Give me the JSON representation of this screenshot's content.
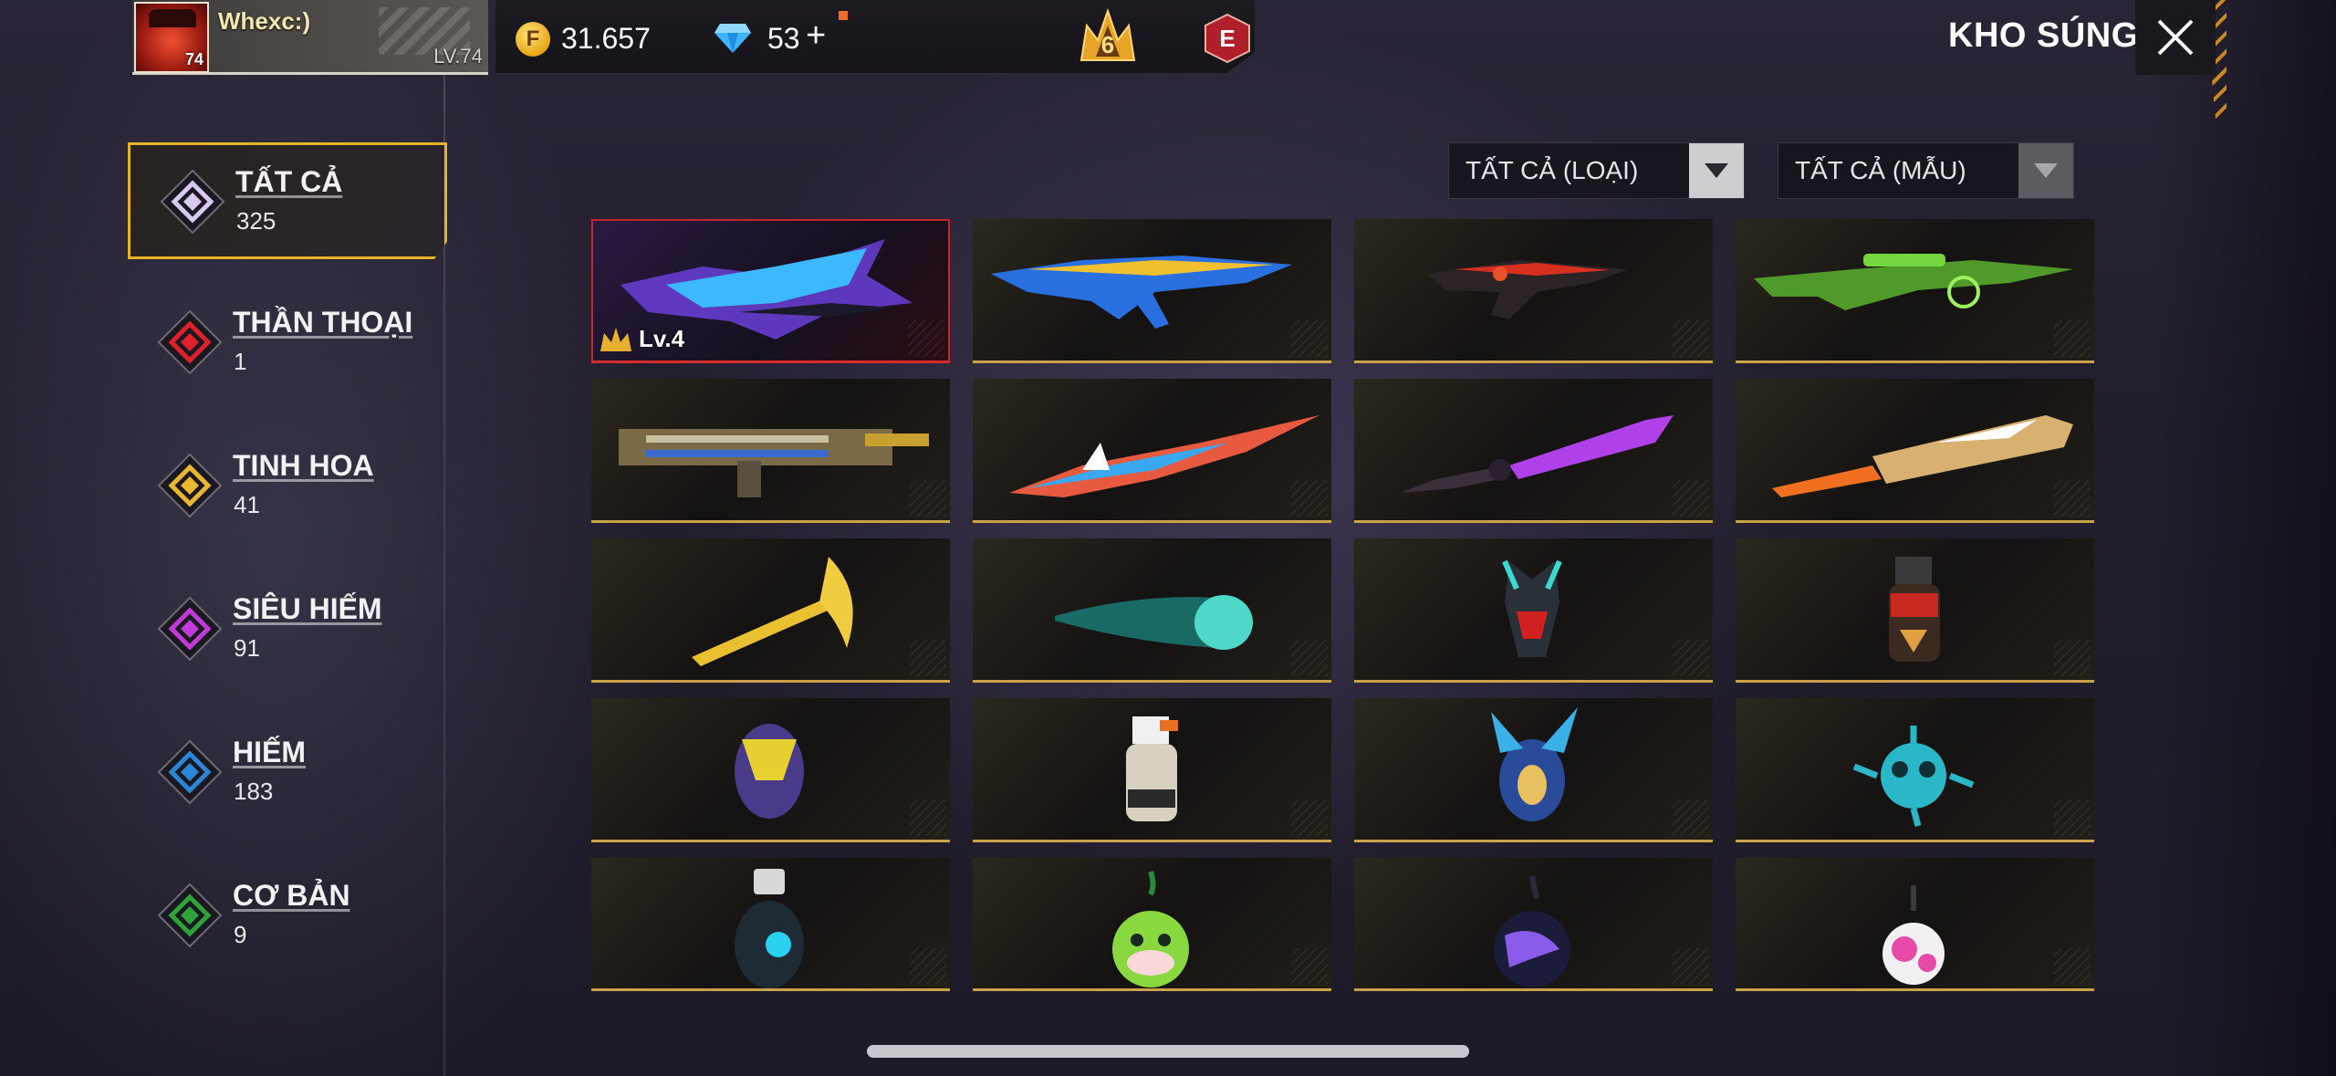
{
  "player": {
    "name": "Whexc:)",
    "avatar_level": "74",
    "level_label": "LV.74"
  },
  "currency": {
    "coins": "31.657",
    "diamonds": "53",
    "plus": "+",
    "crown_rank": "6",
    "elite_letter": "E"
  },
  "header": {
    "title": "KHO SÚNG"
  },
  "categories": [
    {
      "label": "TẤT CẢ",
      "count": "325",
      "color": "#d9c8f0"
    },
    {
      "label": "THẦN THOẠI",
      "count": "1",
      "color": "#e0202a"
    },
    {
      "label": "TINH HOA",
      "count": "41",
      "color": "#e9b630"
    },
    {
      "label": "SIÊU HIẾM",
      "count": "91",
      "color": "#c03ad8"
    },
    {
      "label": "HIẾM",
      "count": "183",
      "color": "#2c86d8"
    },
    {
      "label": "CƠ BẢN",
      "count": "9",
      "color": "#2da33a"
    }
  ],
  "filters": {
    "type_label": "TẤT CẢ (LOẠI)",
    "style_label": "TẤT CẢ (MẪU)"
  },
  "items": [
    {
      "kind": "dragon-rifle-icon",
      "badge": "Lv.4"
    },
    {
      "kind": "blue-gold-rifle-icon"
    },
    {
      "kind": "black-red-rifle-icon"
    },
    {
      "kind": "green-sniper-icon"
    },
    {
      "kind": "gold-heavy-rifle-icon"
    },
    {
      "kind": "blue-red-blade-icon"
    },
    {
      "kind": "purple-sword-icon"
    },
    {
      "kind": "cricket-bat-icon"
    },
    {
      "kind": "golden-scythe-icon"
    },
    {
      "kind": "teal-fist-icon"
    },
    {
      "kind": "red-skull-grenade-icon"
    },
    {
      "kind": "red-canister-grenade-icon"
    },
    {
      "kind": "gold-purple-grenade-icon"
    },
    {
      "kind": "white-canister-grenade-icon"
    },
    {
      "kind": "blue-horned-grenade-icon"
    },
    {
      "kind": "teal-spiky-grenade-icon"
    },
    {
      "kind": "dark-tech-grenade-icon"
    },
    {
      "kind": "frog-grenade-icon"
    },
    {
      "kind": "purple-bomb-icon"
    },
    {
      "kind": "pink-bomb-icon"
    }
  ]
}
